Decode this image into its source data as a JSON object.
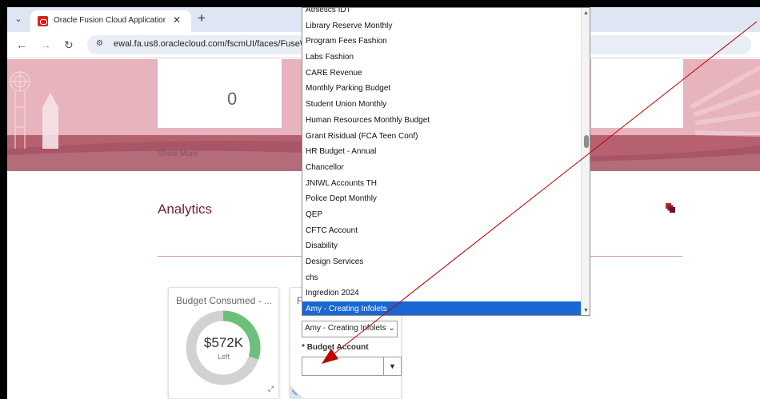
{
  "browser": {
    "tab_title": "Oracle Fusion Cloud Application",
    "tab_close": "✕",
    "new_tab": "+",
    "tab_menu": "⌄",
    "url": "ewal.fa.us8.oraclecloud.com/fscmUI/faces/FuseW"
  },
  "banner": {
    "count": "0",
    "show_more": "Show More"
  },
  "analytics": {
    "title": "Analytics"
  },
  "budget_widget": {
    "title": "Budget Consumed - ...",
    "value": "$572K",
    "sublabel": "Left",
    "consumed_fraction": 0.3,
    "colors": {
      "consumed": "#6cc07a",
      "remaining": "#d2d2d2"
    }
  },
  "filter_widget": {
    "title_fragment": "F",
    "selected_value": "Amy - Creating Infolets",
    "budget_account_label": "Budget Account",
    "required_mark": "*"
  },
  "dropdown": {
    "items": [
      "Athletics IDT",
      "Library Reserve Monthly",
      "Program Fees Fashion",
      "Labs Fashion",
      "CARE Revenue",
      "Monthly Parking Budget",
      "Student Union Monthly",
      "Human Resources Monthly Budget",
      "Grant Risidual (FCA Teen Conf)",
      "HR Budget - Annual",
      "Chancellor",
      "JNIWL Accounts TH",
      "Police Dept Monthly",
      "QEP",
      "CFTC Account",
      "Disability",
      "Design Services",
      "chs",
      "Ingredion 2024",
      "Amy - Creating Infolets"
    ],
    "selected_index": 19,
    "selected_color": "#1a66d2"
  },
  "colors": {
    "brand": "#7a2035",
    "annotation_arrow": "#c00000"
  }
}
